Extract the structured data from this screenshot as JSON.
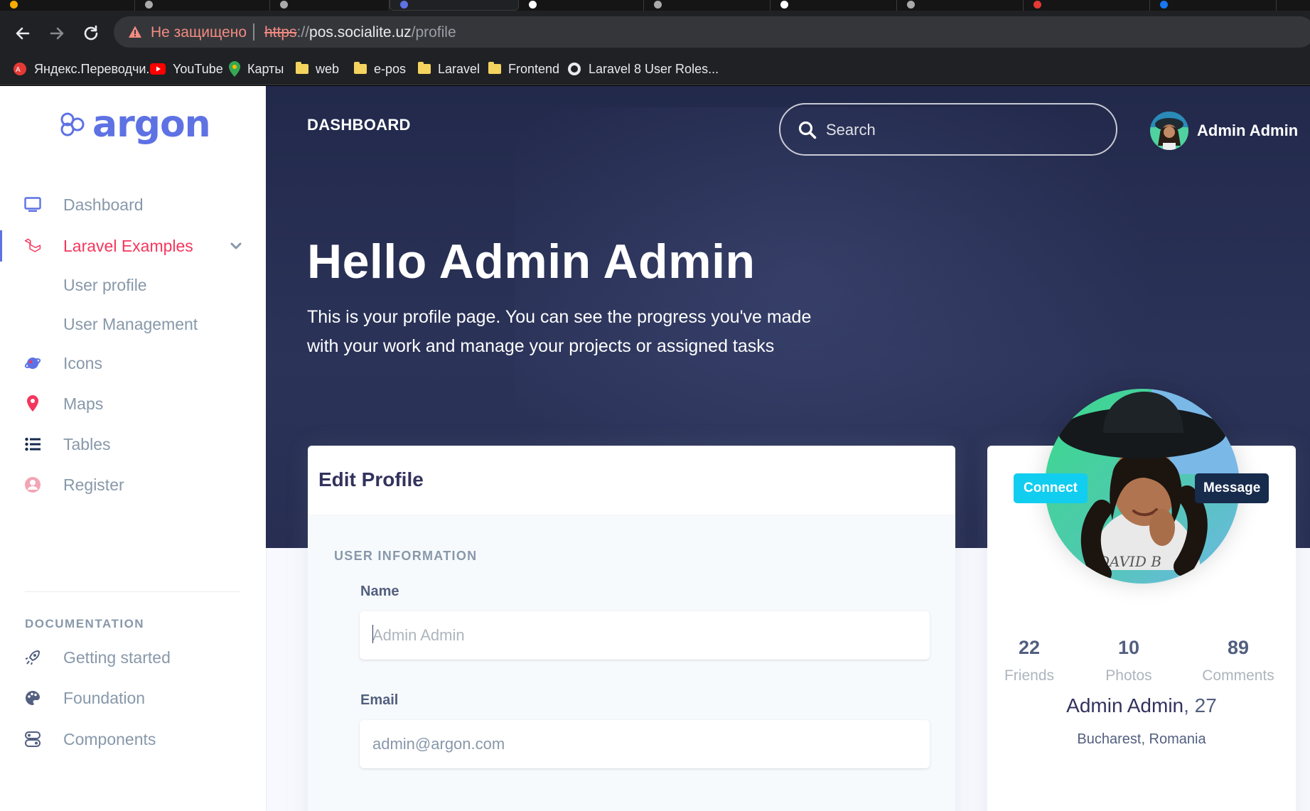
{
  "browser": {
    "not_secure": "Не защищено",
    "url_scheme": "https",
    "url_sep": "://",
    "url_host": "pos.socialite.uz",
    "url_path": "/profile",
    "bookmarks": [
      {
        "label": "Яндекс.Переводчи...",
        "icon": "yandex-translate-icon"
      },
      {
        "label": "YouTube",
        "icon": "youtube-icon"
      },
      {
        "label": "Карты",
        "icon": "maps-pin-icon"
      },
      {
        "label": "web",
        "icon": "folder-icon"
      },
      {
        "label": "e-pos",
        "icon": "folder-icon"
      },
      {
        "label": "Laravel",
        "icon": "folder-icon"
      },
      {
        "label": "Frontend",
        "icon": "folder-icon"
      },
      {
        "label": "Laravel 8 User Roles...",
        "icon": "site-icon"
      }
    ]
  },
  "sidebar": {
    "brand": "argon",
    "items": [
      {
        "label": "Dashboard",
        "icon": "tv-icon"
      },
      {
        "label": "Laravel Examples",
        "icon": "laravel-icon",
        "active": true
      },
      {
        "label": "User profile"
      },
      {
        "label": "User Management"
      },
      {
        "label": "Icons",
        "icon": "planet-icon"
      },
      {
        "label": "Maps",
        "icon": "pin-icon"
      },
      {
        "label": "Tables",
        "icon": "bullet-list-icon"
      },
      {
        "label": "Register",
        "icon": "circle-user-icon"
      }
    ],
    "doc_heading": "DOCUMENTATION",
    "doc_items": [
      {
        "label": "Getting started",
        "icon": "rocket-icon"
      },
      {
        "label": "Foundation",
        "icon": "palette-icon"
      },
      {
        "label": "Components",
        "icon": "ui-04-icon"
      }
    ]
  },
  "header": {
    "title": "DASHBOARD",
    "search_placeholder": "Search",
    "user_name": "Admin Admin",
    "hero_title": "Hello Admin Admin",
    "hero_text": "This is your profile page. You can see the progress you've made with your work and manage your projects or assigned tasks"
  },
  "edit_profile": {
    "title": "Edit Profile",
    "section": "USER INFORMATION",
    "name_label": "Name",
    "name_placeholder": "Admin Admin",
    "email_label": "Email",
    "email_value": "admin@argon.com"
  },
  "profile_card": {
    "connect": "Connect",
    "message": "Message",
    "stats": [
      {
        "value": "22",
        "label": "Friends"
      },
      {
        "value": "10",
        "label": "Photos"
      },
      {
        "value": "89",
        "label": "Comments"
      }
    ],
    "name": "Admin Admin",
    "age": ", 27",
    "location": "Bucharest, Romania"
  },
  "colors": {
    "primary": "#5e72e4",
    "active": "#f5365c",
    "info": "#11cdef",
    "default": "#172b4d",
    "header_bg": "#22294b"
  }
}
